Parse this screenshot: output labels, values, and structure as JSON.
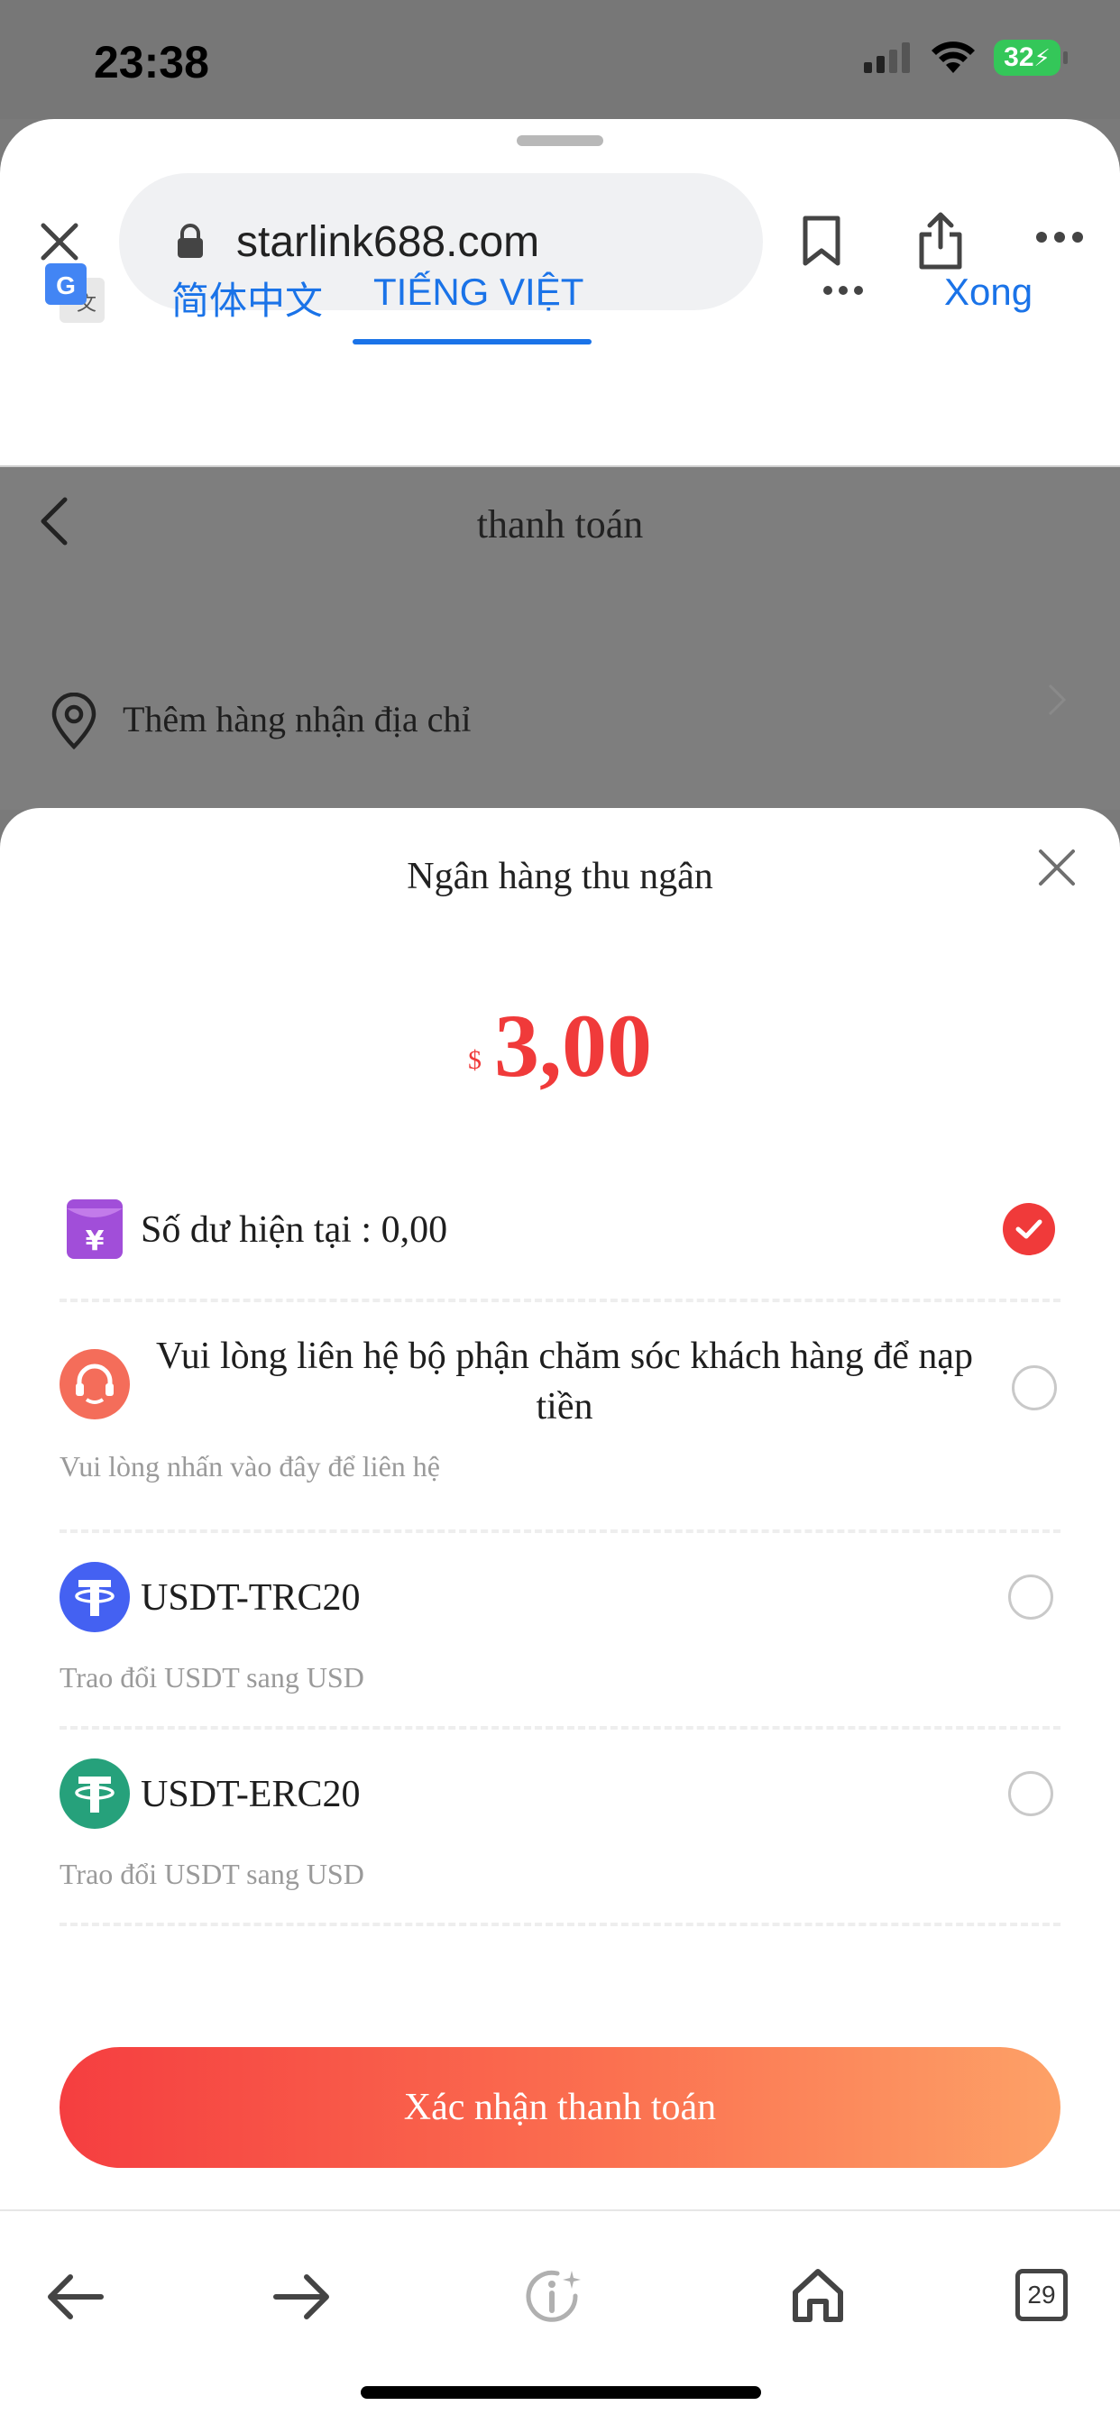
{
  "status_bar": {
    "time": "23:38",
    "battery": "32"
  },
  "browser": {
    "url": "starlink688.com",
    "translate": {
      "tab_zh": "简体中文",
      "tab_vi": "TIẾNG VIỆT",
      "done": "Xong"
    }
  },
  "page": {
    "title": "thanh toán",
    "address_prompt": "Thêm hàng nhận địa chỉ"
  },
  "cashier": {
    "title": "Ngân hàng thu ngân",
    "currency": "$",
    "amount": "3,00",
    "options": [
      {
        "title": "Số dư hiện tại : 0,00",
        "subtitle": "",
        "icon": "wallet-yen-icon",
        "selected": true
      },
      {
        "title": "Vui lòng liên hệ bộ phận chăm sóc khách hàng để nạp tiền",
        "subtitle": "Vui lòng nhấn vào đây để liên hệ",
        "icon": "customer-service-icon",
        "selected": false
      },
      {
        "title": "USDT-TRC20",
        "subtitle": "Trao đổi USDT sang USD",
        "icon": "tether-icon",
        "selected": false
      },
      {
        "title": "USDT-ERC20",
        "subtitle": "Trao đổi USDT sang USD",
        "icon": "tether-icon",
        "selected": false
      }
    ],
    "confirm_label": "Xác nhận thanh toán"
  },
  "toolbar": {
    "tabs_count": "29"
  },
  "colors": {
    "accent_red": "#f03a3a",
    "link_blue": "#1a73e8",
    "wallet_purple": "#a14ed9",
    "service_orange": "#f46d5a",
    "trc20_blue": "#4461f2",
    "erc20_green": "#26a17b"
  }
}
